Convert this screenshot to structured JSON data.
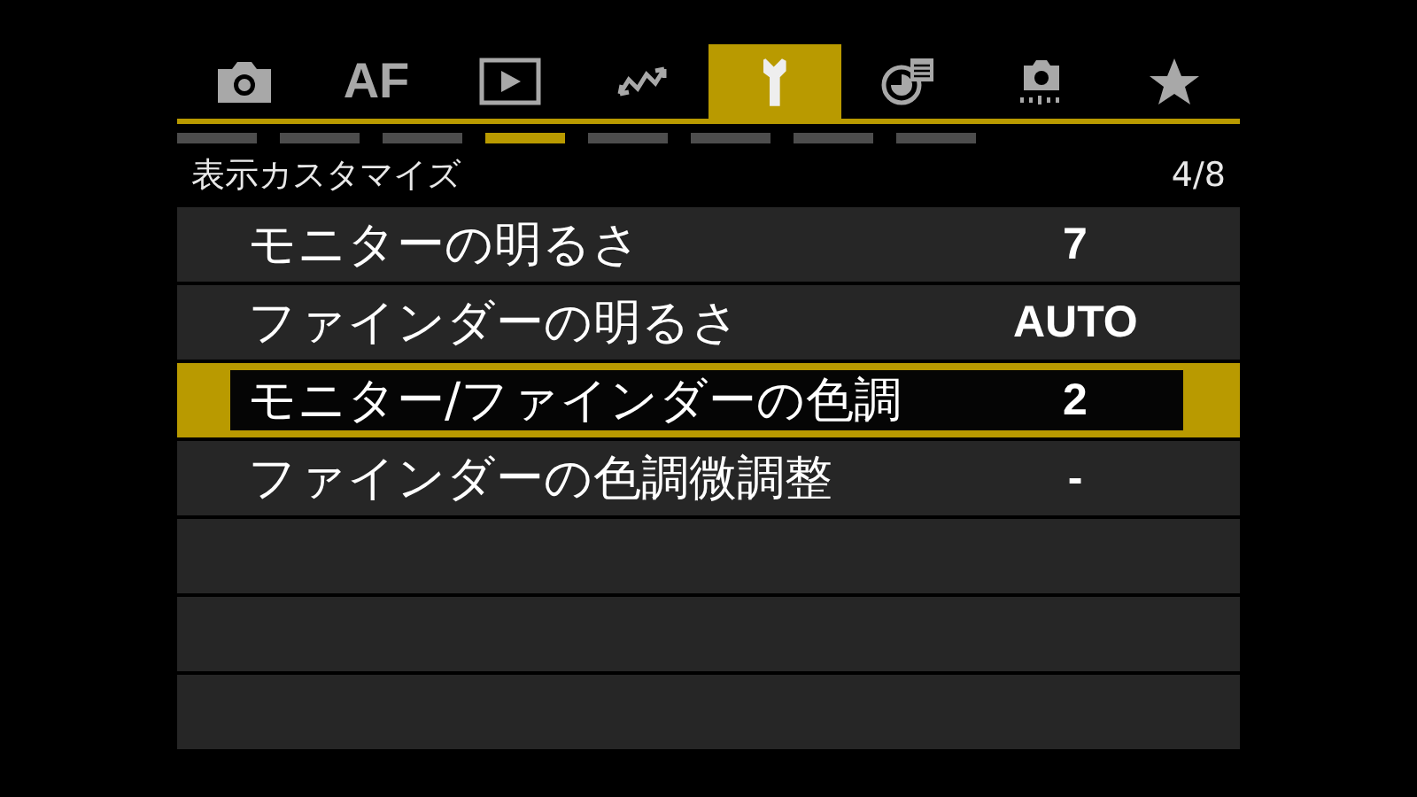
{
  "tabs": [
    {
      "kind": "camera",
      "selected": false
    },
    {
      "kind": "text",
      "label": "AF",
      "selected": false
    },
    {
      "kind": "play",
      "selected": false
    },
    {
      "kind": "wave",
      "selected": false
    },
    {
      "kind": "wrench",
      "selected": true
    },
    {
      "kind": "chart",
      "selected": false
    },
    {
      "kind": "camera-dots",
      "selected": false
    },
    {
      "kind": "star",
      "selected": false
    }
  ],
  "pages": [
    {
      "selected": false
    },
    {
      "selected": false
    },
    {
      "selected": false
    },
    {
      "selected": true
    },
    {
      "selected": false
    },
    {
      "selected": false
    },
    {
      "selected": false
    },
    {
      "selected": false
    }
  ],
  "header": {
    "title": "表示カスタマイズ",
    "page": "4/8"
  },
  "items": [
    {
      "kind": "setting",
      "label": "モニターの明るさ",
      "value": "7",
      "selected": false
    },
    {
      "kind": "setting",
      "label": "ファインダーの明るさ",
      "value": "AUTO",
      "selected": false
    },
    {
      "kind": "setting",
      "label": "モニター/ファインダーの色調",
      "value": "2",
      "selected": true
    },
    {
      "kind": "setting",
      "label": "ファインダーの色調微調整",
      "value": "-",
      "selected": false
    },
    {
      "kind": "empty",
      "selected": false
    },
    {
      "kind": "empty",
      "selected": false
    },
    {
      "kind": "empty",
      "selected": false
    }
  ]
}
